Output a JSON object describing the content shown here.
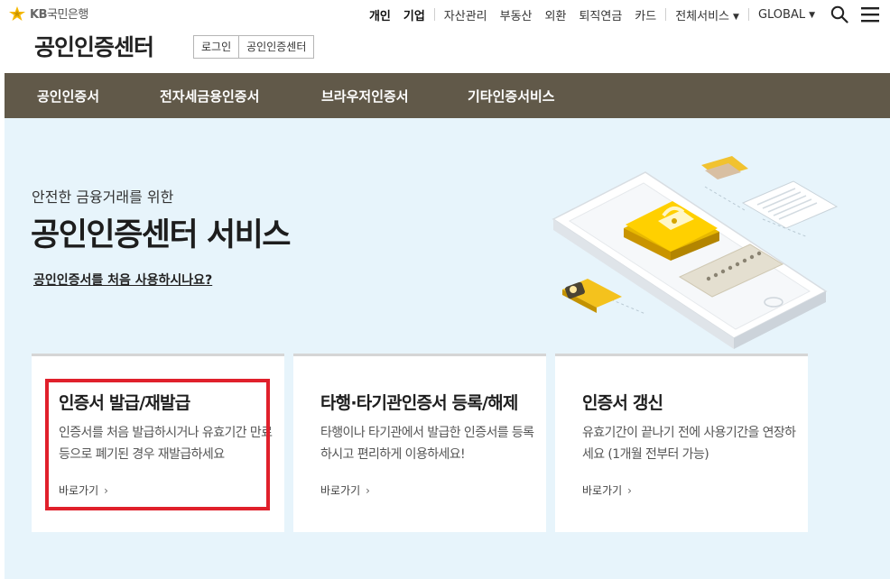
{
  "brand": {
    "logo_kb": "KB",
    "logo_name": "국민은행",
    "colors": {
      "star_yellow": "#f5b800",
      "menu_bg": "#615949",
      "hero_bg": "#e7f4fb",
      "highlight": "#e0202b"
    }
  },
  "util_nav": {
    "primary": [
      {
        "label": "개인"
      },
      {
        "label": "기업"
      }
    ],
    "secondary": [
      {
        "label": "자산관리"
      },
      {
        "label": "부동산"
      },
      {
        "label": "외환"
      },
      {
        "label": "퇴직연금"
      },
      {
        "label": "카드"
      }
    ],
    "all_services": "전체서비스",
    "global": "GLOBAL",
    "icons": [
      "search-icon",
      "hamburger-menu-icon"
    ]
  },
  "site": {
    "title": "공인인증센터",
    "sub_links": [
      {
        "label": "로그인"
      },
      {
        "label": "공인인증센터"
      }
    ]
  },
  "menu": [
    {
      "label": "공인인증서"
    },
    {
      "label": "전자세금용인증서"
    },
    {
      "label": "브라우저인증서"
    },
    {
      "label": "기타인증서비스"
    }
  ],
  "hero": {
    "kicker": "안전한 금융거래를 위한",
    "title": "공인인증센터 서비스",
    "link": "공인인증서를 처음 사용하시나요?"
  },
  "cards": [
    {
      "title": "인증서 발급/재발급",
      "desc": "인증서를 처음 발급하시거나 유효기간 만료 등으로 폐기된 경우 재발급하세요",
      "more": "바로가기"
    },
    {
      "title": "타행·타기관인증서 등록/해제",
      "desc": "타행이나 타기관에서 발급한 인증서를 등록하시고 편리하게 이용하세요!",
      "more": "바로가기"
    },
    {
      "title": "인증서 갱신",
      "desc": "유효기간이 끝나기 전에 사용기간을 연장하세요 (1개월 전부터 가능)",
      "more": "바로가기"
    }
  ]
}
